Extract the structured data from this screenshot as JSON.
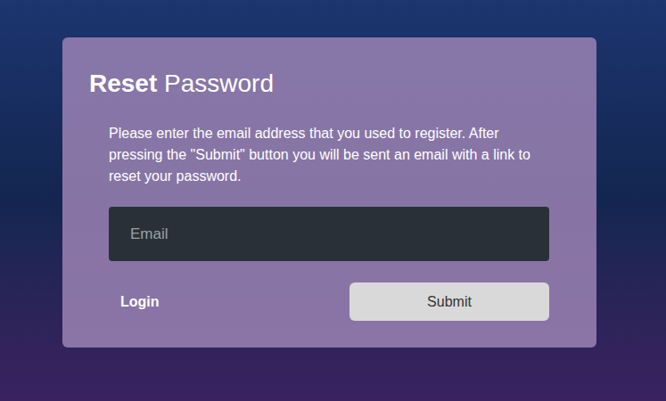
{
  "page": {
    "title_bold": "Reset",
    "title_light": "Password"
  },
  "form": {
    "description": "Please enter the email address that you used to register. After pressing the \"Submit\" button you will be sent an email with a link to reset your password.",
    "email": {
      "placeholder": "Email",
      "value": ""
    }
  },
  "links": [
    {
      "label": "Login"
    }
  ],
  "buttons": [
    {
      "label": "Submit"
    }
  ]
}
